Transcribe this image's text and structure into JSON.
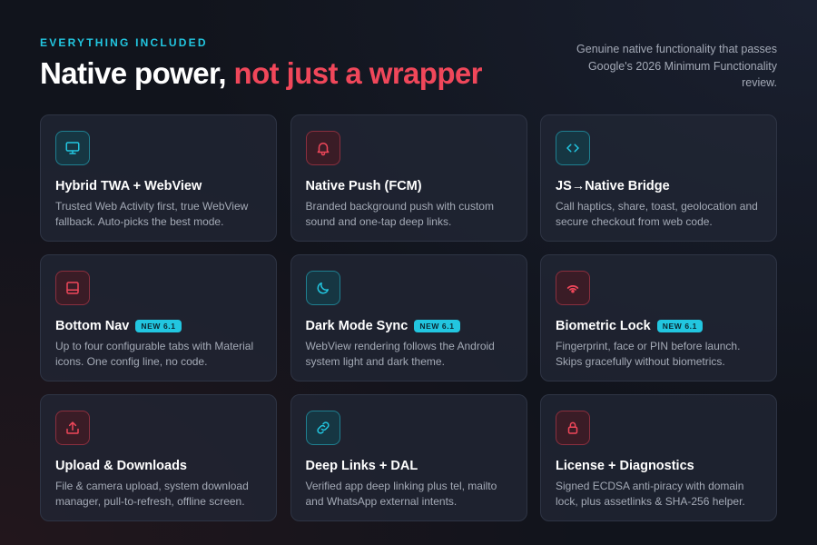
{
  "header": {
    "eyebrow": "EVERYTHING INCLUDED",
    "title_main": "Native power, ",
    "title_accent": "not just a wrapper",
    "subtitle": "Genuine native functionality that passes Google's 2026 Minimum Functionality review."
  },
  "colors": {
    "cyan": "#22c6e0",
    "red": "#f0475a",
    "background": "#11141c"
  },
  "cards": [
    {
      "icon": "monitor-icon",
      "tone": "cyan",
      "title": "Hybrid TWA + WebView",
      "badge": "",
      "desc": "Trusted Web Activity first, true WebView fallback. Auto-picks the best mode."
    },
    {
      "icon": "bell-icon",
      "tone": "red",
      "title": "Native Push (FCM)",
      "badge": "",
      "desc": "Branded background push with custom sound and one-tap deep links."
    },
    {
      "icon": "code-icon",
      "tone": "cyan",
      "title": "JS→Native Bridge",
      "badge": "",
      "desc": "Call haptics, share, toast, geolocation and secure checkout from web code."
    },
    {
      "icon": "bottom-nav-icon",
      "tone": "red",
      "title": "Bottom Nav",
      "badge": "NEW 6.1",
      "desc": "Up to four configurable tabs with Material icons. One config line, no code."
    },
    {
      "icon": "moon-icon",
      "tone": "cyan",
      "title": "Dark Mode Sync",
      "badge": "NEW 6.1",
      "desc": "WebView rendering follows the Android system light and dark theme."
    },
    {
      "icon": "fingerprint-icon",
      "tone": "red",
      "title": "Biometric Lock",
      "badge": "NEW 6.1",
      "desc": "Fingerprint, face or PIN before launch. Skips gracefully without biometrics."
    },
    {
      "icon": "upload-icon",
      "tone": "red",
      "title": "Upload & Downloads",
      "badge": "",
      "desc": "File & camera upload, system download manager, pull-to-refresh, offline screen."
    },
    {
      "icon": "link-icon",
      "tone": "cyan",
      "title": "Deep Links + DAL",
      "badge": "",
      "desc": "Verified app deep linking plus tel, mailto and WhatsApp external intents."
    },
    {
      "icon": "lock-icon",
      "tone": "red",
      "title": "License + Diagnostics",
      "badge": "",
      "desc": "Signed ECDSA anti-piracy with domain lock, plus assetlinks & SHA-256 helper."
    }
  ]
}
